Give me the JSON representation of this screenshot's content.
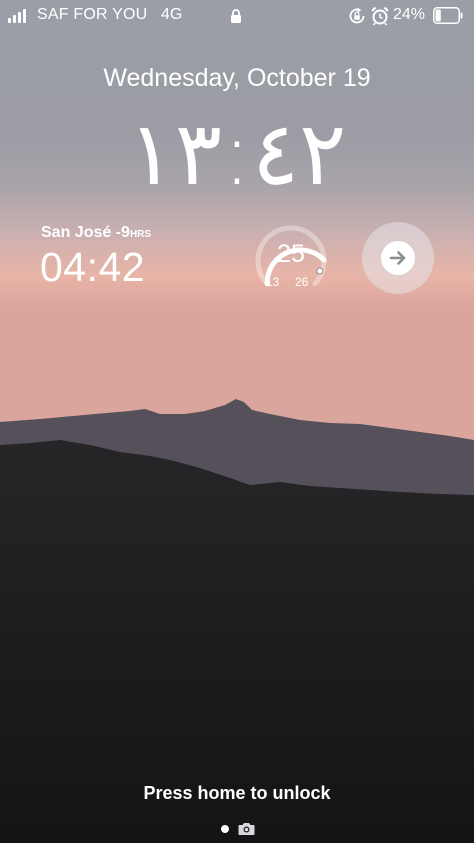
{
  "status_bar": {
    "carrier": "SAF FOR YOU",
    "network": "4G",
    "battery_percent": "24%",
    "battery_level": 0.24,
    "icons": [
      "signal-icon",
      "lock-icon",
      "rotation-lock-icon",
      "alarm-icon",
      "battery-icon"
    ]
  },
  "lock_screen": {
    "date": "Wednesday, October 19",
    "time": "١٣:٤٢"
  },
  "widgets": {
    "world_clock": {
      "city": "San José",
      "offset": "-9",
      "offset_unit": "HRS",
      "time": "04:42"
    },
    "weather": {
      "current_temp": "25",
      "low": "13",
      "high": "26"
    },
    "shortcut": {
      "icon": "arrow-right-icon"
    }
  },
  "footer": {
    "unlock_hint": "Press home to unlock",
    "icons": [
      "page-dot-icon",
      "camera-icon"
    ]
  },
  "colors": {
    "sky_top": "#9ea1a9",
    "sky_horizon": "#e6b2a8",
    "mountain": "#55505a",
    "ground": "#19191b"
  }
}
